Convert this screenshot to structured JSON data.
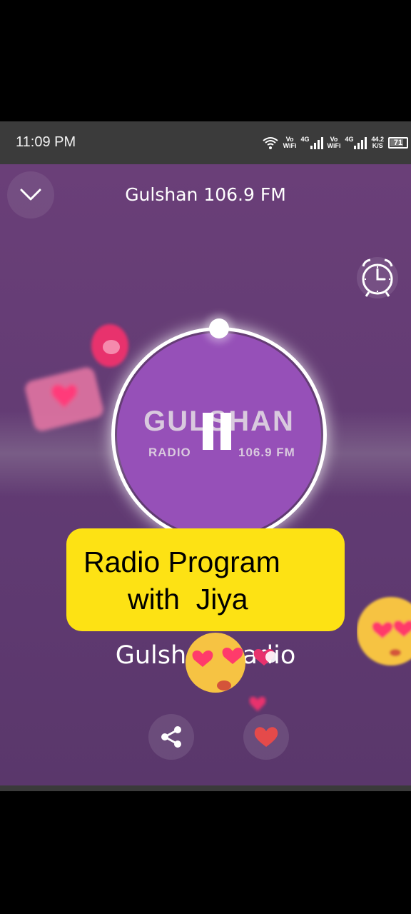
{
  "status_bar": {
    "time": "11:09 PM",
    "sim1_label_top": "Vo",
    "sim1_label_bottom": "WiFi",
    "sim1_network": "4G",
    "sim2_label_top": "Vo",
    "sim2_label_bottom": "WiFi",
    "sim2_network": "4G",
    "speed_value": "44.2",
    "speed_unit": "K/S",
    "battery": "71"
  },
  "player": {
    "station_title": "Gulshan 106.9 FM",
    "logo": {
      "name": "GULSHAN",
      "left_text": "RADIO",
      "right_text": "106.9 FM"
    },
    "caption": {
      "line1": "Radio Program",
      "line2": "with  Jiya"
    },
    "station_subtitle": "Gulshan Radio",
    "icons": {
      "collapse": "chevron-down-icon",
      "alarm": "alarm-clock-icon",
      "pause": "pause-icon",
      "share": "share-icon",
      "like": "heart-icon"
    }
  },
  "colors": {
    "background": "#633c74",
    "disc": "#9650b8",
    "caption_bg": "#fde214",
    "heart": "#e54a4a"
  }
}
